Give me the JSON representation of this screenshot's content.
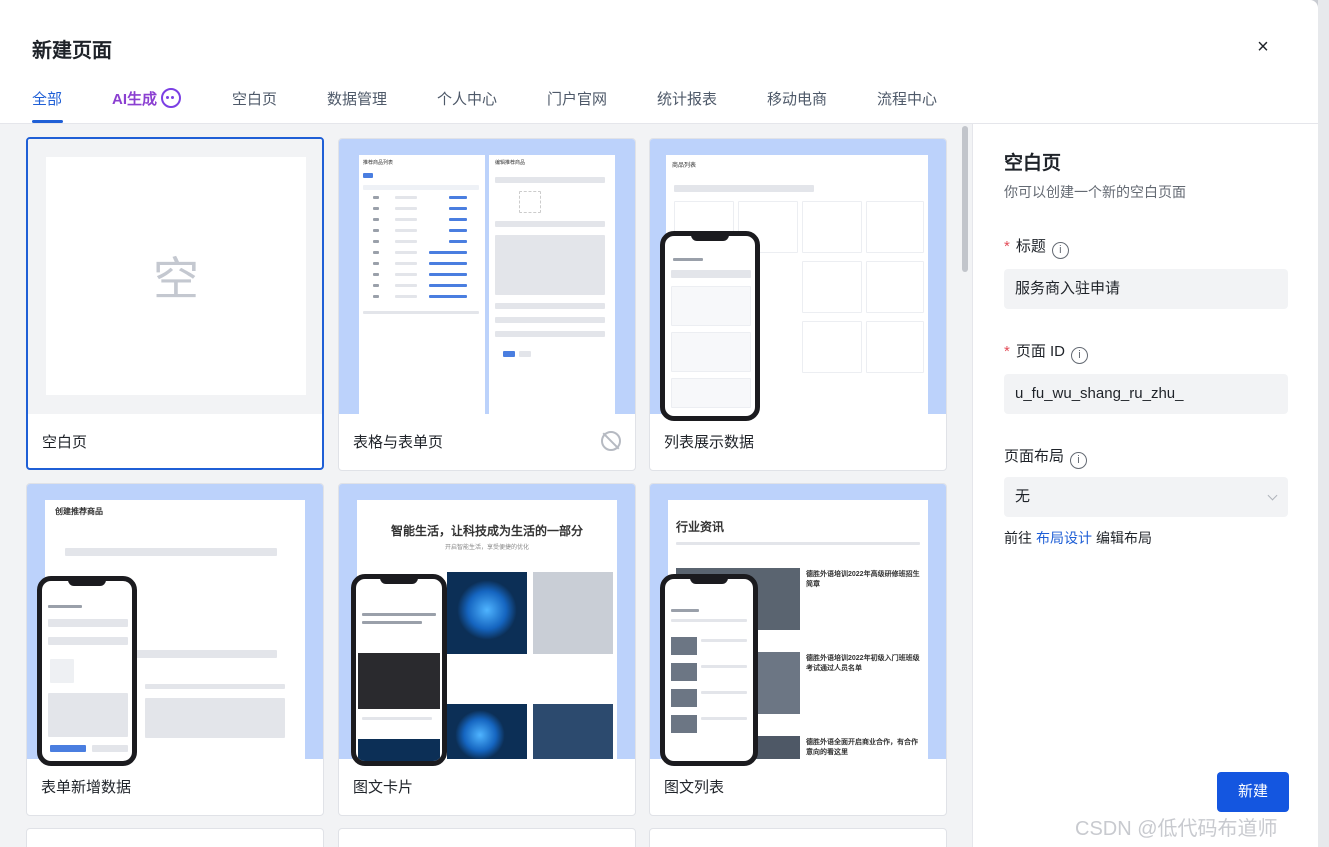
{
  "modal": {
    "title": "新建页面",
    "close_label": "×"
  },
  "tabs": [
    {
      "label": "全部",
      "active": true
    },
    {
      "label": "AI生成",
      "active": false
    },
    {
      "label": "空白页",
      "active": false
    },
    {
      "label": "数据管理",
      "active": false
    },
    {
      "label": "个人中心",
      "active": false
    },
    {
      "label": "门户官网",
      "active": false
    },
    {
      "label": "统计报表",
      "active": false
    },
    {
      "label": "移动电商",
      "active": false
    },
    {
      "label": "流程中心",
      "active": false
    }
  ],
  "templates": [
    {
      "label": "空白页",
      "placeholder": "空",
      "selected": true
    },
    {
      "label": "表格与表单页"
    },
    {
      "label": "列表展示数据"
    },
    {
      "label": "表单新增数据"
    },
    {
      "label": "图文卡片"
    },
    {
      "label": "图文列表"
    }
  ],
  "preview_text": {
    "table_title": "推荐商品列表",
    "edit_title": "编辑推荐商品",
    "list_title": "商品列表",
    "create_title": "创建推荐商品",
    "card_headline": "智能生活，让科技成为生活的一部分",
    "card_subline": "开启智能生活，享受便捷的优化",
    "news_title": "行业资讯",
    "news_items": [
      "德胜外语培训2022年高级研修班招生简章",
      "德胜外语培训2022年初级入门班班级考试通过人员名单",
      "德胜外语全面开启商业合作，有合作意向的看这里"
    ]
  },
  "panel": {
    "title": "空白页",
    "description": "你可以创建一个新的空白页面",
    "fields": {
      "title_label": "标题",
      "title_value": "服务商入驻申请",
      "page_id_label": "页面 ID",
      "page_id_value": "u_fu_wu_shang_ru_zhu_",
      "layout_label": "页面布局",
      "layout_value": "无"
    },
    "goto_prefix": "前往",
    "goto_link": "布局设计",
    "edit_layout": "编辑布局",
    "create_button": "新建"
  },
  "watermark": "CSDN @低代码布道师",
  "colors": {
    "primary": "#1456e0",
    "ai_purple": "#8b3fd1",
    "required": "#e34d59",
    "thumb_bg": "#bcd2fb"
  }
}
